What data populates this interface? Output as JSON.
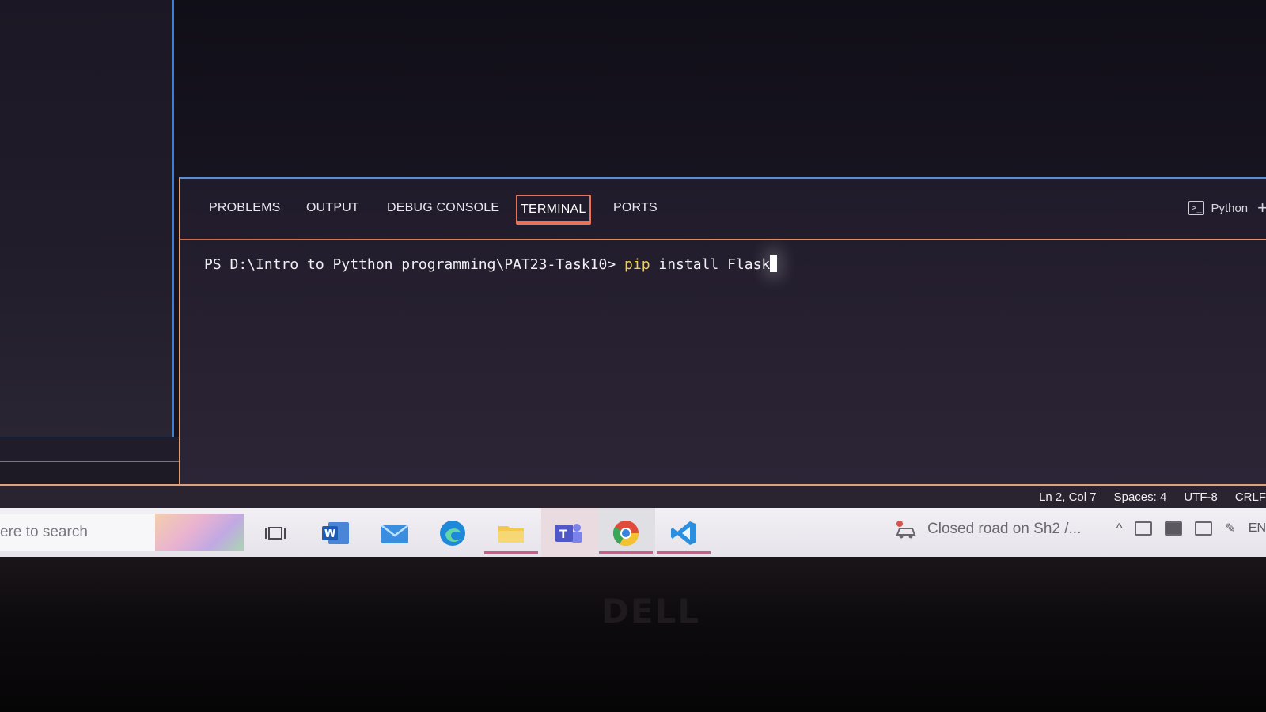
{
  "panel": {
    "tabs": [
      {
        "label": "PROBLEMS",
        "active": false
      },
      {
        "label": "OUTPUT",
        "active": false
      },
      {
        "label": "DEBUG CONSOLE",
        "active": false
      },
      {
        "label": "TERMINAL",
        "active": true
      },
      {
        "label": "PORTS",
        "active": false
      }
    ],
    "shell_label": "Python",
    "add_terminal": "+"
  },
  "terminal": {
    "prompt": "PS D:\\Intro to Pytthon programming\\PAT23-Task10> ",
    "command": "pip",
    "args": " install Flask"
  },
  "status_bar": {
    "position": "Ln 2, Col 7",
    "spaces": "Spaces: 4",
    "encoding": "UTF-8",
    "eol": "CRLF"
  },
  "taskbar": {
    "search_placeholder": "ere to search",
    "apps": [
      {
        "name": "task-view-icon"
      },
      {
        "name": "word-icon"
      },
      {
        "name": "mail-icon"
      },
      {
        "name": "edge-icon"
      },
      {
        "name": "file-explorer-icon"
      },
      {
        "name": "teams-icon"
      },
      {
        "name": "chrome-icon"
      },
      {
        "name": "vscode-icon"
      }
    ],
    "news": "Closed road on Sh2 /...",
    "tray_language": "EN"
  },
  "colors": {
    "accent_active_tab": "#e8725a",
    "command_highlight": "#f2d04b",
    "vscode_blue": "#3b9be6"
  }
}
